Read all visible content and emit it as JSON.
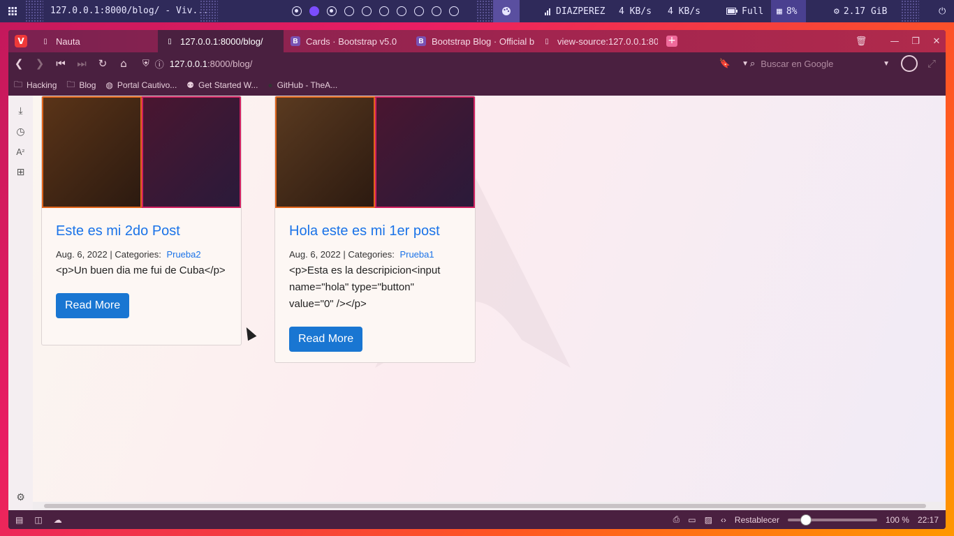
{
  "panel": {
    "window_title": "127.0.0.1:8000/blog/ - Viv...",
    "user": "DIAZPEREZ",
    "net_down": "4 KB/s",
    "net_up": "4 KB/s",
    "battery": "Full",
    "cpu": "8%",
    "memory": "2.17 GiB"
  },
  "tabs": [
    {
      "label": "Nauta",
      "icon": "page-icon"
    },
    {
      "label": "127.0.0.1:8000/blog/",
      "icon": "page-icon"
    },
    {
      "label": "Cards · Bootstrap v5.0",
      "icon": "B"
    },
    {
      "label": "Bootstrap Blog · Official b",
      "icon": "B"
    },
    {
      "label": "view-source:127.0.0.1:800",
      "icon": "page-icon"
    }
  ],
  "address": {
    "host": "127.0.0.1",
    "path": ":8000/blog/",
    "search_placeholder": "Buscar en Google"
  },
  "bookmarks": [
    {
      "label": "Hacking",
      "icon": "folder-icon"
    },
    {
      "label": "Blog",
      "icon": "folder-icon"
    },
    {
      "label": "Portal Cautivo...",
      "icon": "globe-icon"
    },
    {
      "label": "Get Started W...",
      "icon": "python-icon"
    },
    {
      "label": "GitHub - TheA...",
      "icon": "github-icon"
    }
  ],
  "posts": [
    {
      "title": "Este es mi 2do Post",
      "date": "Aug. 6, 2022 |",
      "categories_label": "Categories:",
      "category": "Prueba2",
      "description": "<p>Un buen dia me fui de Cuba</p>",
      "button": "Read More"
    },
    {
      "title": "Hola este es mi 1er post",
      "date": "Aug. 6, 2022 |",
      "categories_label": "Categories:",
      "category": "Prueba1",
      "description": "<p>Esta es la descripicion<input name=\"hola\" type=\"button\" value=\"0\" /></p>",
      "button": "Read More"
    }
  ],
  "statusbar": {
    "reset_label": "Restablecer",
    "zoom": "100 %",
    "clock": "22:17"
  }
}
